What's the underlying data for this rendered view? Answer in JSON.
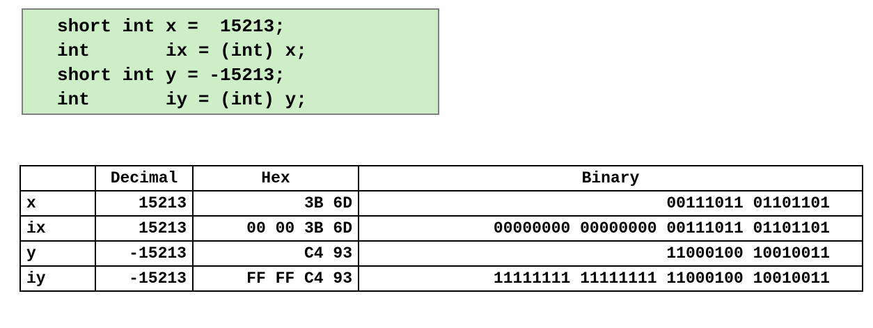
{
  "code": {
    "lines": [
      "short int x =  15213;",
      "int       ix = (int) x;",
      "short int y = -15213;",
      "int       iy = (int) y;"
    ]
  },
  "table": {
    "headers": [
      "",
      "Decimal",
      "Hex",
      "Binary"
    ],
    "rows": [
      {
        "name": "x",
        "decimal": "15213",
        "hex": "3B 6D",
        "binary": "00111011 01101101"
      },
      {
        "name": "ix",
        "decimal": "15213",
        "hex": "00 00 3B 6D",
        "binary": "00000000 00000000 00111011 01101101"
      },
      {
        "name": "y",
        "decimal": "-15213",
        "hex": "C4 93",
        "binary": "11000100 10010011"
      },
      {
        "name": "iy",
        "decimal": "-15213",
        "hex": "FF FF C4 93",
        "binary": "11111111 11111111 11000100 10010011"
      }
    ]
  },
  "colors": {
    "code_bg": "#cdeec7",
    "code_border": "#808080"
  }
}
